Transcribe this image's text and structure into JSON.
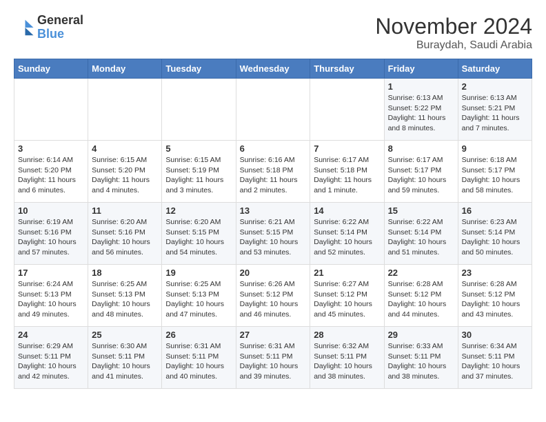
{
  "header": {
    "logo": {
      "line1": "General",
      "line2": "Blue"
    },
    "title": "November 2024",
    "subtitle": "Buraydah, Saudi Arabia"
  },
  "weekdays": [
    "Sunday",
    "Monday",
    "Tuesday",
    "Wednesday",
    "Thursday",
    "Friday",
    "Saturday"
  ],
  "weeks": [
    [
      {
        "day": "",
        "info": ""
      },
      {
        "day": "",
        "info": ""
      },
      {
        "day": "",
        "info": ""
      },
      {
        "day": "",
        "info": ""
      },
      {
        "day": "",
        "info": ""
      },
      {
        "day": "1",
        "info": "Sunrise: 6:13 AM\nSunset: 5:22 PM\nDaylight: 11 hours\nand 8 minutes."
      },
      {
        "day": "2",
        "info": "Sunrise: 6:13 AM\nSunset: 5:21 PM\nDaylight: 11 hours\nand 7 minutes."
      }
    ],
    [
      {
        "day": "3",
        "info": "Sunrise: 6:14 AM\nSunset: 5:20 PM\nDaylight: 11 hours\nand 6 minutes."
      },
      {
        "day": "4",
        "info": "Sunrise: 6:15 AM\nSunset: 5:20 PM\nDaylight: 11 hours\nand 4 minutes."
      },
      {
        "day": "5",
        "info": "Sunrise: 6:15 AM\nSunset: 5:19 PM\nDaylight: 11 hours\nand 3 minutes."
      },
      {
        "day": "6",
        "info": "Sunrise: 6:16 AM\nSunset: 5:18 PM\nDaylight: 11 hours\nand 2 minutes."
      },
      {
        "day": "7",
        "info": "Sunrise: 6:17 AM\nSunset: 5:18 PM\nDaylight: 11 hours\nand 1 minute."
      },
      {
        "day": "8",
        "info": "Sunrise: 6:17 AM\nSunset: 5:17 PM\nDaylight: 10 hours\nand 59 minutes."
      },
      {
        "day": "9",
        "info": "Sunrise: 6:18 AM\nSunset: 5:17 PM\nDaylight: 10 hours\nand 58 minutes."
      }
    ],
    [
      {
        "day": "10",
        "info": "Sunrise: 6:19 AM\nSunset: 5:16 PM\nDaylight: 10 hours\nand 57 minutes."
      },
      {
        "day": "11",
        "info": "Sunrise: 6:20 AM\nSunset: 5:16 PM\nDaylight: 10 hours\nand 56 minutes."
      },
      {
        "day": "12",
        "info": "Sunrise: 6:20 AM\nSunset: 5:15 PM\nDaylight: 10 hours\nand 54 minutes."
      },
      {
        "day": "13",
        "info": "Sunrise: 6:21 AM\nSunset: 5:15 PM\nDaylight: 10 hours\nand 53 minutes."
      },
      {
        "day": "14",
        "info": "Sunrise: 6:22 AM\nSunset: 5:14 PM\nDaylight: 10 hours\nand 52 minutes."
      },
      {
        "day": "15",
        "info": "Sunrise: 6:22 AM\nSunset: 5:14 PM\nDaylight: 10 hours\nand 51 minutes."
      },
      {
        "day": "16",
        "info": "Sunrise: 6:23 AM\nSunset: 5:14 PM\nDaylight: 10 hours\nand 50 minutes."
      }
    ],
    [
      {
        "day": "17",
        "info": "Sunrise: 6:24 AM\nSunset: 5:13 PM\nDaylight: 10 hours\nand 49 minutes."
      },
      {
        "day": "18",
        "info": "Sunrise: 6:25 AM\nSunset: 5:13 PM\nDaylight: 10 hours\nand 48 minutes."
      },
      {
        "day": "19",
        "info": "Sunrise: 6:25 AM\nSunset: 5:13 PM\nDaylight: 10 hours\nand 47 minutes."
      },
      {
        "day": "20",
        "info": "Sunrise: 6:26 AM\nSunset: 5:12 PM\nDaylight: 10 hours\nand 46 minutes."
      },
      {
        "day": "21",
        "info": "Sunrise: 6:27 AM\nSunset: 5:12 PM\nDaylight: 10 hours\nand 45 minutes."
      },
      {
        "day": "22",
        "info": "Sunrise: 6:28 AM\nSunset: 5:12 PM\nDaylight: 10 hours\nand 44 minutes."
      },
      {
        "day": "23",
        "info": "Sunrise: 6:28 AM\nSunset: 5:12 PM\nDaylight: 10 hours\nand 43 minutes."
      }
    ],
    [
      {
        "day": "24",
        "info": "Sunrise: 6:29 AM\nSunset: 5:11 PM\nDaylight: 10 hours\nand 42 minutes."
      },
      {
        "day": "25",
        "info": "Sunrise: 6:30 AM\nSunset: 5:11 PM\nDaylight: 10 hours\nand 41 minutes."
      },
      {
        "day": "26",
        "info": "Sunrise: 6:31 AM\nSunset: 5:11 PM\nDaylight: 10 hours\nand 40 minutes."
      },
      {
        "day": "27",
        "info": "Sunrise: 6:31 AM\nSunset: 5:11 PM\nDaylight: 10 hours\nand 39 minutes."
      },
      {
        "day": "28",
        "info": "Sunrise: 6:32 AM\nSunset: 5:11 PM\nDaylight: 10 hours\nand 38 minutes."
      },
      {
        "day": "29",
        "info": "Sunrise: 6:33 AM\nSunset: 5:11 PM\nDaylight: 10 hours\nand 38 minutes."
      },
      {
        "day": "30",
        "info": "Sunrise: 6:34 AM\nSunset: 5:11 PM\nDaylight: 10 hours\nand 37 minutes."
      }
    ]
  ]
}
